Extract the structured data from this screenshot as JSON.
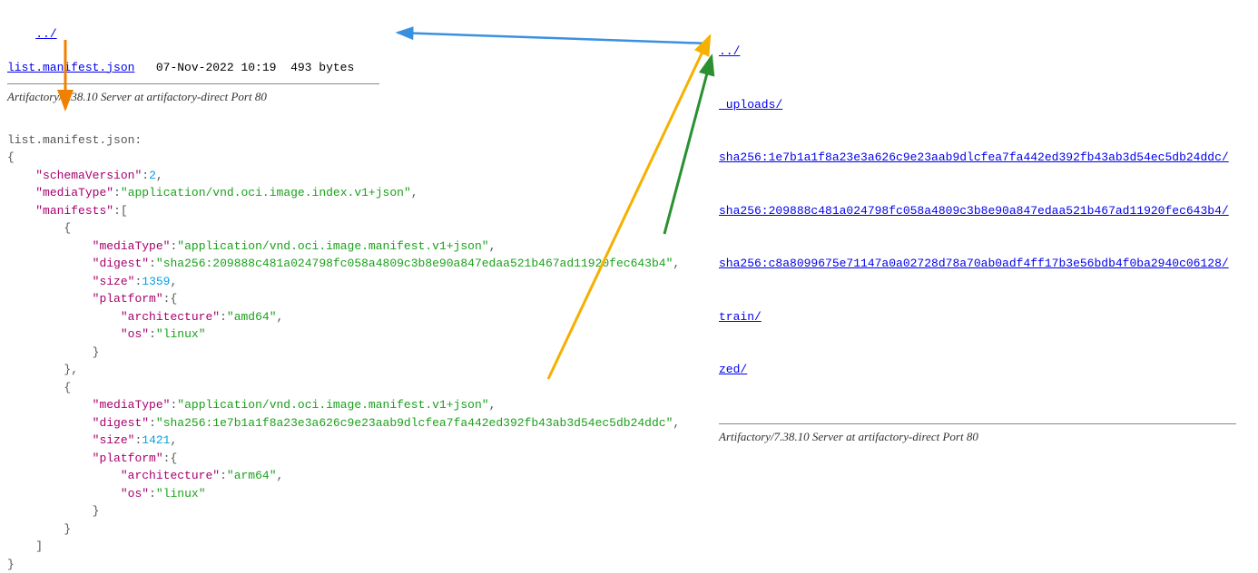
{
  "left": {
    "parent_link": "../",
    "file": {
      "name": "list.manifest.json",
      "date": "07-Nov-2022 10:19",
      "size": "493 bytes"
    },
    "server": "Artifactory/7.38.10 Server at artifactory-direct Port 80",
    "json_label": "list.manifest.json:"
  },
  "right": {
    "parent_link": "../",
    "links": [
      "_uploads/",
      "sha256:1e7b1a1f8a23e3a626c9e23aab9dlcfea7fa442ed392fb43ab3d54ec5db24ddc/",
      "sha256:209888c481a024798fc058a4809c3b8e90a847edaa521b467ad11920fec643b4/",
      "sha256:c8a8099675e71147a0a02728d78a70ab0adf4ff17b3e56bdb4f0ba2940c06128/",
      "train/",
      "zed/"
    ],
    "server": "Artifactory/7.38.10 Server at artifactory-direct Port 80"
  },
  "json": {
    "schemaVersion_key": "schemaVersion",
    "schemaVersion_val": "2",
    "mediaType_key": "mediaType",
    "mediaType_val": "application/vnd.oci.image.index.v1+json",
    "manifests_key": "manifests",
    "m1_mediaType_val": "application/vnd.oci.image.manifest.v1+json",
    "m1_digest_val": "sha256:209888c481a024798fc058a4809c3b8e90a847edaa521b467ad11920fec643b4",
    "m1_size_val": "1359",
    "m1_arch_val": "amd64",
    "m1_os_val": "linux",
    "m2_mediaType_val": "application/vnd.oci.image.manifest.v1+json",
    "m2_digest_val": "sha256:1e7b1a1f8a23e3a626c9e23aab9dlcfea7fa442ed392fb43ab3d54ec5db24ddc",
    "m2_size_val": "1421",
    "m2_arch_val": "arm64",
    "m2_os_val": "linux",
    "k_digest": "digest",
    "k_size": "size",
    "k_platform": "platform",
    "k_arch": "architecture",
    "k_os": "os"
  }
}
